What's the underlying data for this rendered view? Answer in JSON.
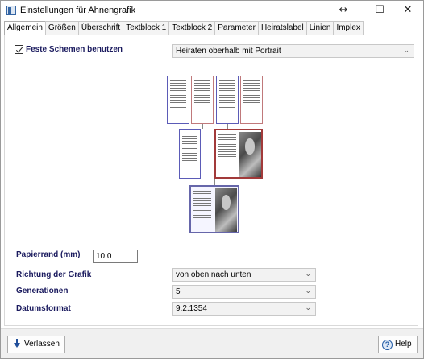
{
  "window": {
    "title": "Einstellungen für Ahnengrafik",
    "controls": {
      "resize": "↔",
      "minimize": "—",
      "maximize": "☐",
      "close": "✕"
    }
  },
  "tabs": [
    {
      "label": "Allgemein",
      "active": true
    },
    {
      "label": "Größen"
    },
    {
      "label": "Überschrift"
    },
    {
      "label": "Textblock 1"
    },
    {
      "label": "Textblock 2"
    },
    {
      "label": "Parameter"
    },
    {
      "label": "Heiratslabel"
    },
    {
      "label": "Linien"
    },
    {
      "label": "Implex"
    }
  ],
  "general": {
    "fixed_schemes_label": "Feste Schemen benutzen",
    "fixed_schemes_checked": true,
    "scheme_select": "Heiraten oberhalb mit Portrait",
    "paper_margin_label": "Papierrand (mm)",
    "paper_margin_value": "10,0",
    "direction_label": "Richtung der Grafik",
    "direction_value": "von oben nach unten",
    "generations_label": "Generationen",
    "generations_value": "5",
    "date_format_label": "Datumsformat",
    "date_format_value": "9.2.1354"
  },
  "footer": {
    "leave_label": "Verlassen",
    "help_label": "Help"
  },
  "icons": {
    "select_chevron": "⌄"
  }
}
